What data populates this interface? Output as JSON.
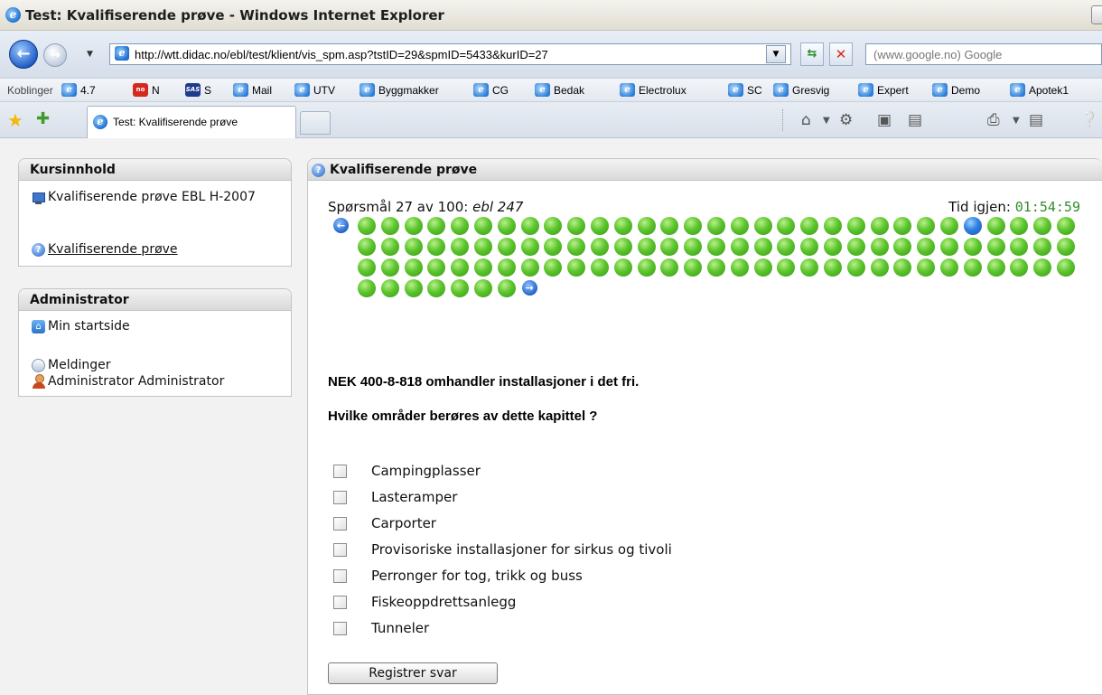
{
  "window": {
    "title": "Test: Kvalifiserende prøve - Windows Internet Explorer"
  },
  "address_bar": {
    "url": "http://wtt.didac.no/ebl/test/klient/vis_spm.asp?tstID=29&spmID=5433&kurID=27",
    "search_placeholder": "(www.google.no) Google"
  },
  "links_bar": {
    "label": "Koblinger",
    "items": [
      {
        "label": "4.7",
        "icon": "ie-icon"
      },
      {
        "label": "N",
        "icon": "red-flag-icon"
      },
      {
        "label": "S",
        "icon": "sas-icon"
      },
      {
        "label": "Mail",
        "icon": "ie-icon"
      },
      {
        "label": "UTV",
        "icon": "ie-icon"
      },
      {
        "label": "Byggmakker",
        "icon": "ie-icon"
      },
      {
        "label": "CG",
        "icon": "ie-icon"
      },
      {
        "label": "Bedak",
        "icon": "ie-icon"
      },
      {
        "label": "Electrolux",
        "icon": "ie-icon"
      },
      {
        "label": "SC",
        "icon": "ie-icon"
      },
      {
        "label": "Gresvig",
        "icon": "ie-icon"
      },
      {
        "label": "Expert",
        "icon": "ie-icon"
      },
      {
        "label": "Demo",
        "icon": "ie-icon"
      },
      {
        "label": "Apotek1",
        "icon": "ie-icon"
      }
    ]
  },
  "tabs": {
    "active_label": "Test: Kvalifiserende prøve"
  },
  "sidebar": {
    "course_panel": {
      "header": "Kursinnhold",
      "course_title": "Kvalifiserende prøve EBL H-2007",
      "test_link": "Kvalifiserende prøve"
    },
    "admin_panel": {
      "header": "Administrator",
      "home_link": "Min startside",
      "messages_link": "Meldinger",
      "user_name": "Administrator Administrator"
    }
  },
  "main": {
    "header": "Kvalifiserende prøve",
    "question_counter_prefix": "Spørsmål 27 av 100:",
    "question_ref": "ebl 247",
    "timer_label": "Tid igjen:",
    "timer_value": "01:54:59",
    "total_questions": 100,
    "current_question": 27,
    "question": "NEK 400-8-818 omhandler installasjoner i det fri.",
    "sub_question": "Hvilke områder berøres av dette kapittel ?",
    "options": [
      "Campingplasser",
      "Lasteramper",
      "Carporter",
      "Provisoriske installasjoner for sirkus og tivoli",
      "Perronger for tog, trikk og buss",
      "Fiskeoppdrettsanlegg",
      "Tunneler"
    ],
    "submit_label": "Registrer svar"
  },
  "colors": {
    "answered_dot": "#5cc52d",
    "current_dot": "#2e7fe0",
    "timer": "#2f8f2f"
  }
}
